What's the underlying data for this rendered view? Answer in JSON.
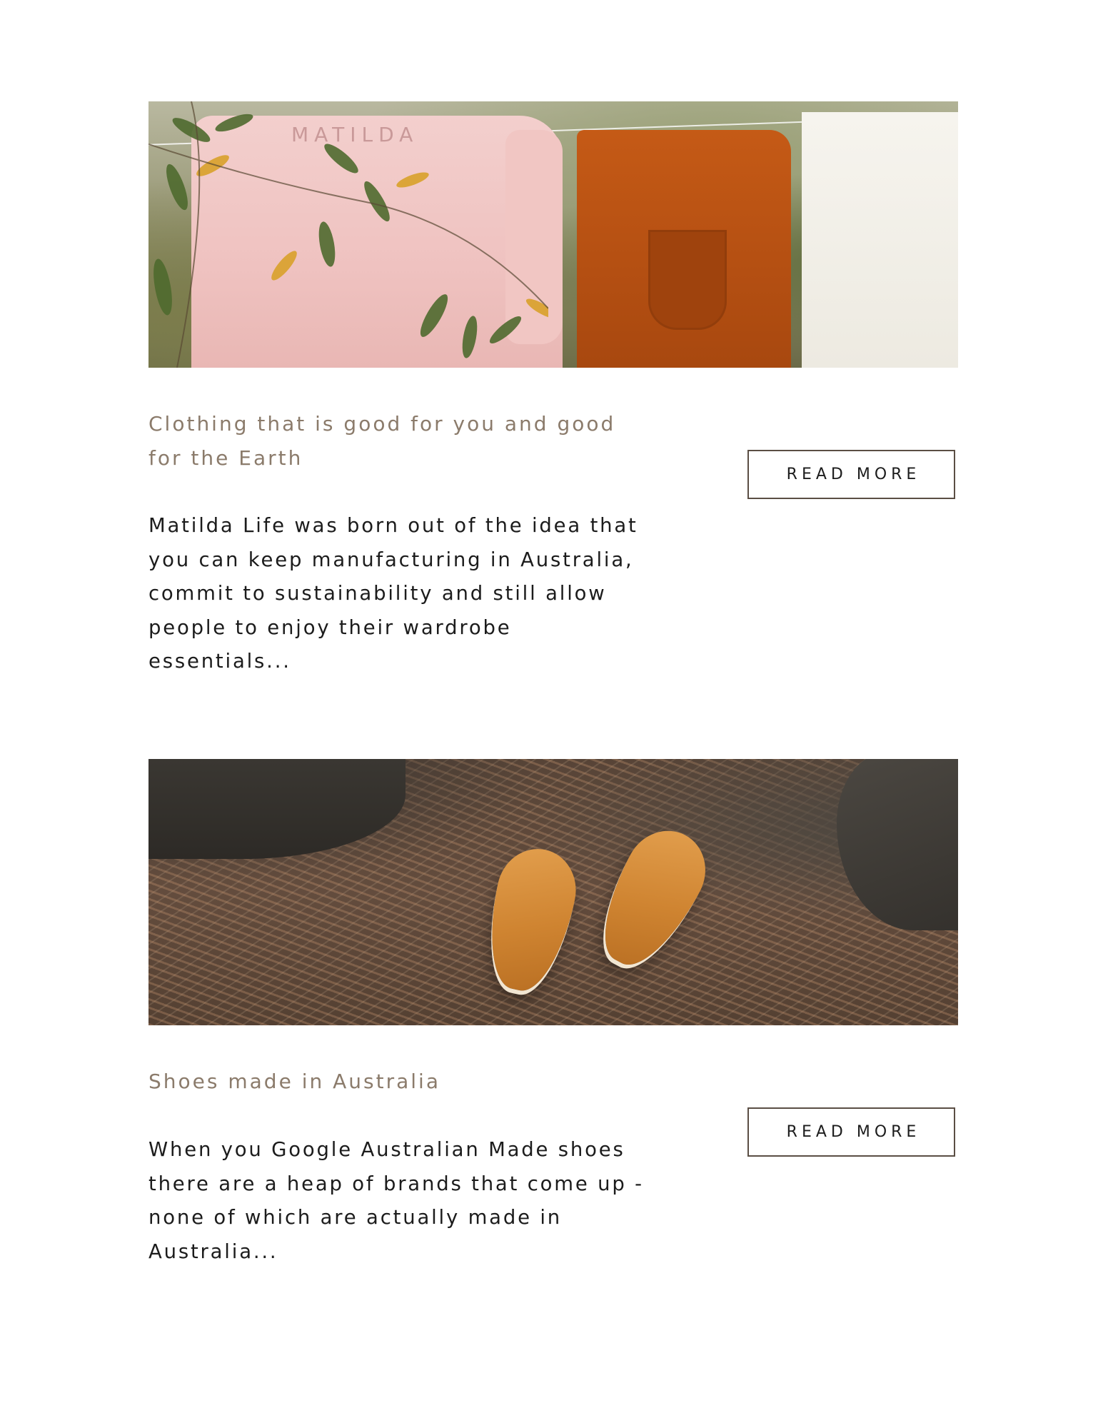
{
  "posts": [
    {
      "title": "Clothing that is good for you and good for the Earth",
      "excerpt": "Matilda Life was born out of the idea that you can keep manufacturing in Australia, commit to sustainability and still allow people to enjoy their wardrobe essentials...",
      "button_label": "READ MORE",
      "image_logo_text": "MATILDA"
    },
    {
      "title": "Shoes made in Australia",
      "excerpt": "When you Google Australian Made shoes there are a heap of brands that come up - none of which are actually made in Australia...",
      "button_label": "READ MORE"
    }
  ],
  "colors": {
    "title": "#8b7b6b",
    "body_text": "#1c1c1c",
    "button_border": "#5a4e44",
    "background": "#ffffff"
  }
}
